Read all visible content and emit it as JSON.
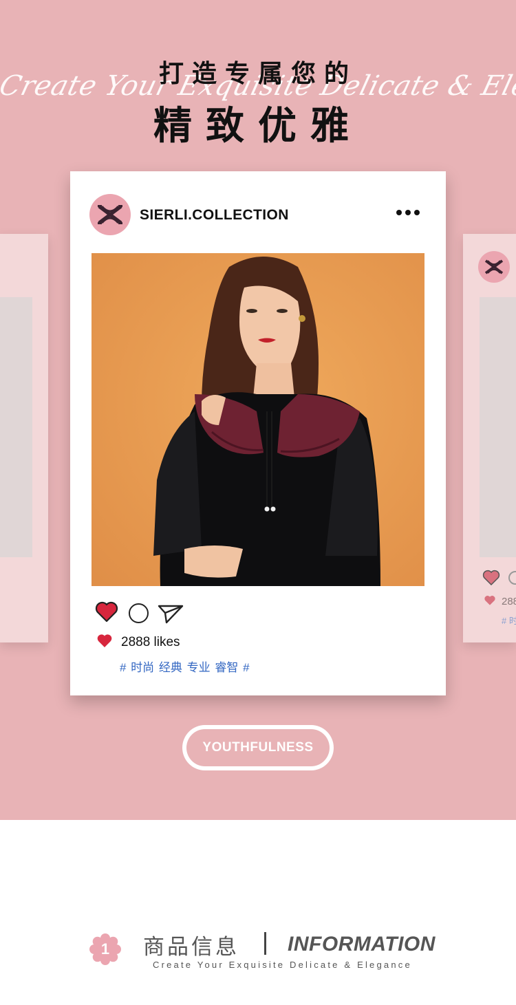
{
  "hero": {
    "title_line1": "打造专属您的",
    "script_text": "Create Your Exquisite Delicate & Elegance",
    "title_line2": "精致优雅"
  },
  "post": {
    "username": "SIERLI.COLLECTION",
    "avatar_icon": "monogram-logo-icon",
    "photo_alt": "model-photo",
    "likes_text": "2888 likes",
    "hashtags": "# 时尚 经典 专业 睿智 #"
  },
  "side_post": {
    "likes_text": "288",
    "hashtags": "# 时"
  },
  "cta": {
    "label": "YOUTHFULNESS"
  },
  "info_section": {
    "number": "1",
    "title_cn": "商品信息",
    "divider": "|",
    "title_en": "INFORMATION",
    "subtitle": "Create Your Exquisite Delicate & Elegance"
  },
  "colors": {
    "page_pink": "#e8b3b6",
    "avatar_pink": "#eba5b0",
    "like_red": "#d7263d",
    "hashtag_blue": "#3367c2"
  }
}
